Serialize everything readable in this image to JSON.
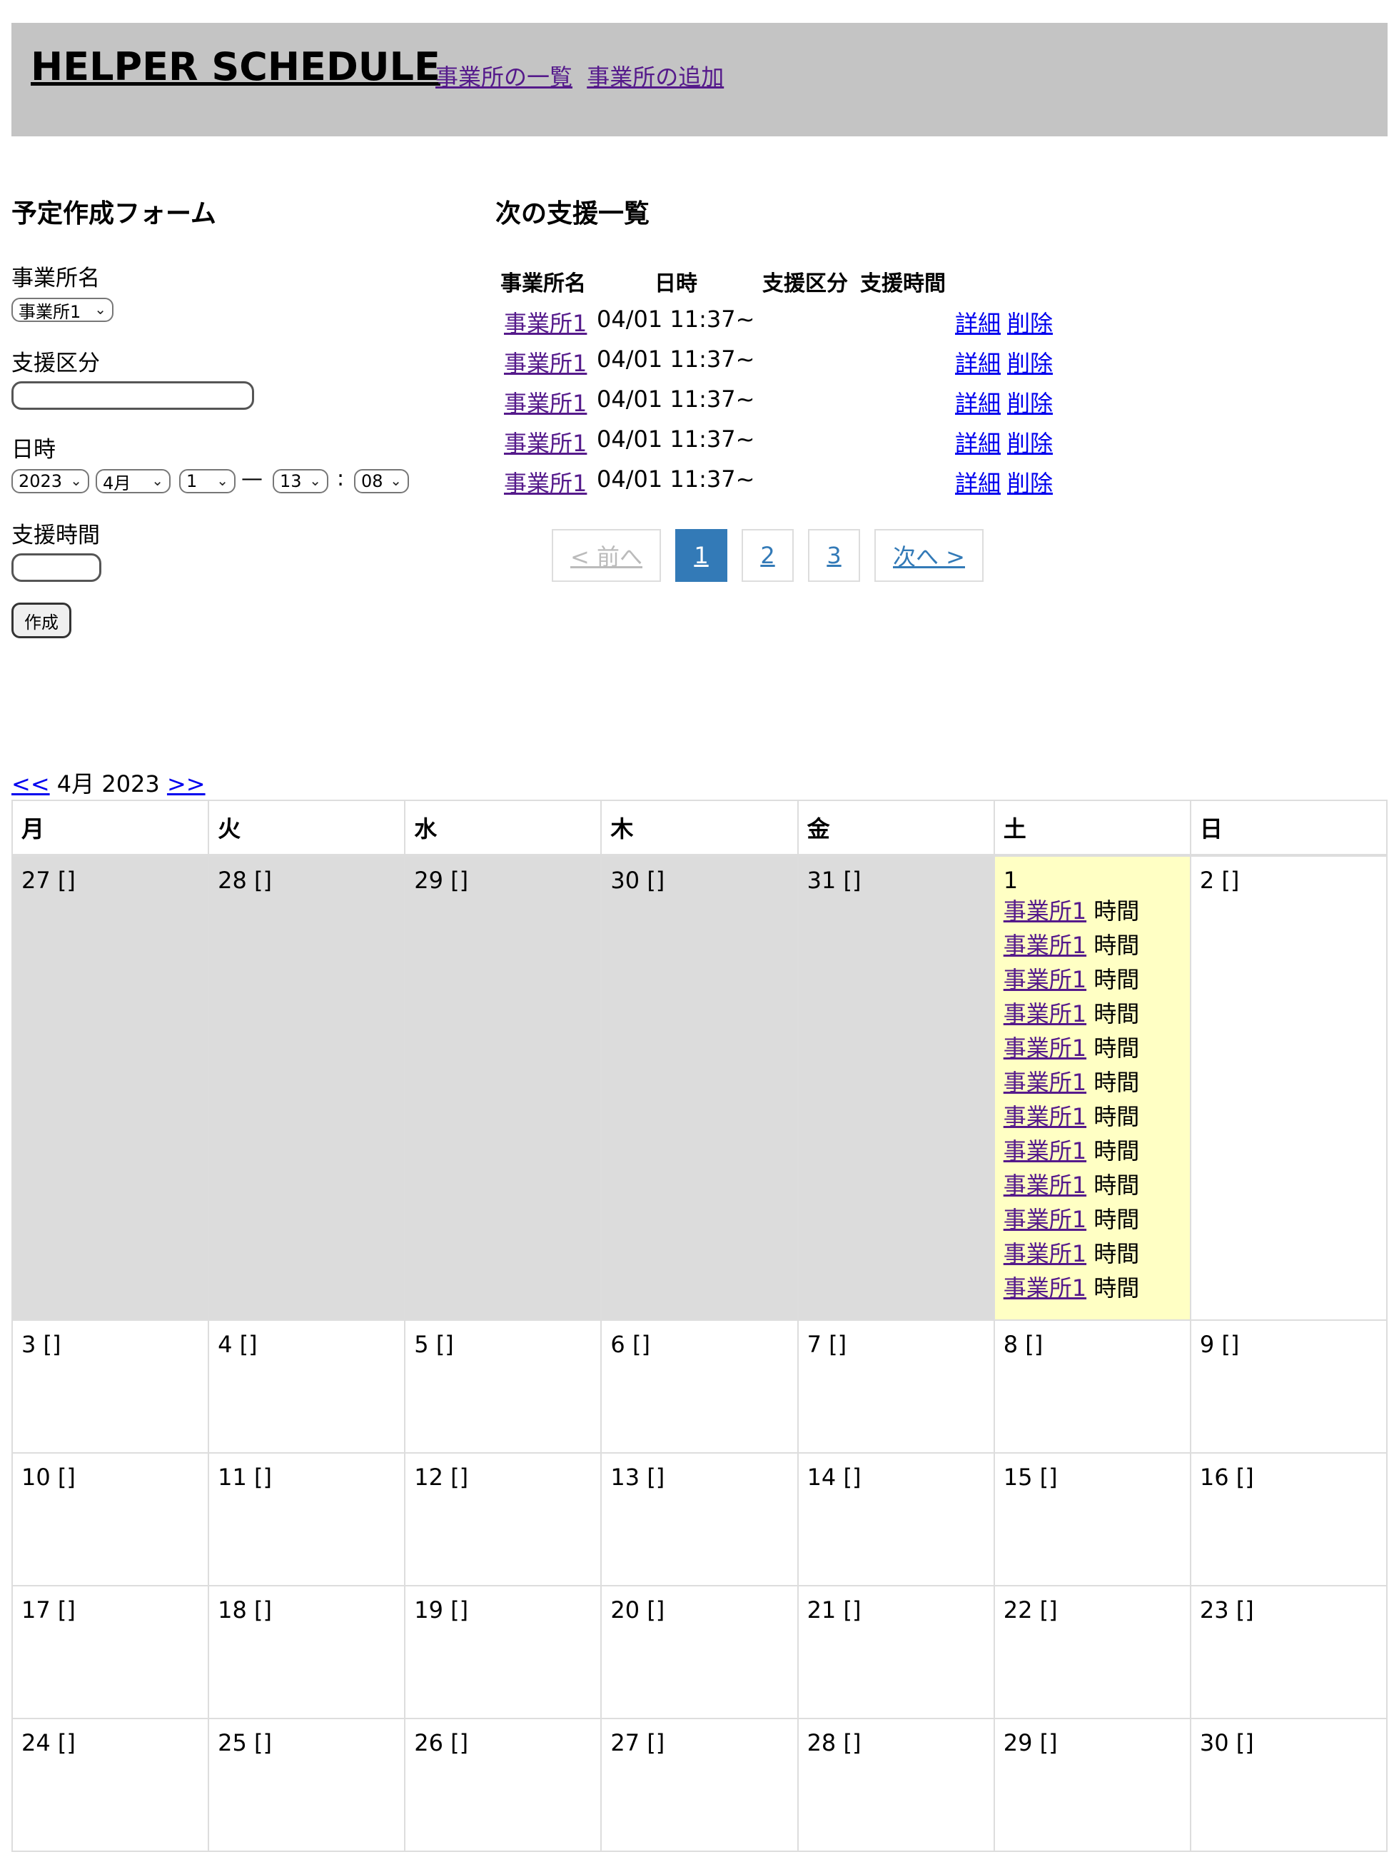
{
  "header": {
    "title": "HELPER SCHEDULE",
    "nav": [
      {
        "label": "事業所の一覧"
      },
      {
        "label": "事業所の追加"
      }
    ]
  },
  "form": {
    "heading": "予定作成フォーム",
    "office_label": "事業所名",
    "office_value": "事業所1",
    "category_label": "支援区分",
    "category_value": "",
    "datetime_label": "日時",
    "year": "2023",
    "month": "4月",
    "day": "1",
    "dash": "—",
    "hour": "13",
    "colon": ":",
    "minute": "08",
    "duration_label": "支援時間",
    "duration_value": "",
    "submit_label": "作成"
  },
  "upcoming": {
    "heading": "次の支援一覧",
    "columns": [
      "事業所名",
      "日時",
      "支援区分",
      "支援時間"
    ],
    "rows": [
      {
        "office": "事業所1",
        "datetime": "04/01 11:37~",
        "detail": "詳細",
        "delete": "削除"
      },
      {
        "office": "事業所1",
        "datetime": "04/01 11:37~",
        "detail": "詳細",
        "delete": "削除"
      },
      {
        "office": "事業所1",
        "datetime": "04/01 11:37~",
        "detail": "詳細",
        "delete": "削除"
      },
      {
        "office": "事業所1",
        "datetime": "04/01 11:37~",
        "detail": "詳細",
        "delete": "削除"
      },
      {
        "office": "事業所1",
        "datetime": "04/01 11:37~",
        "detail": "詳細",
        "delete": "削除"
      }
    ],
    "pagination": {
      "prev": "< 前へ",
      "pages": [
        "1",
        "2",
        "3"
      ],
      "current": "1",
      "next": "次へ >"
    }
  },
  "calendar": {
    "prev_link": "<<",
    "month_label": "4月 2023",
    "next_link": ">>",
    "weekdays": [
      "月",
      "火",
      "水",
      "木",
      "金",
      "土",
      "日"
    ],
    "weeks": [
      [
        {
          "day": "27",
          "suffix": " []",
          "type": "prev"
        },
        {
          "day": "28",
          "suffix": " []",
          "type": "prev"
        },
        {
          "day": "29",
          "suffix": " []",
          "type": "prev"
        },
        {
          "day": "30",
          "suffix": " []",
          "type": "prev"
        },
        {
          "day": "31",
          "suffix": " []",
          "type": "prev"
        },
        {
          "day": "1",
          "suffix": "",
          "type": "today",
          "events": [
            {
              "office": "事業所1",
              "text": " 時間"
            },
            {
              "office": "事業所1",
              "text": " 時間"
            },
            {
              "office": "事業所1",
              "text": " 時間"
            },
            {
              "office": "事業所1",
              "text": " 時間"
            },
            {
              "office": "事業所1",
              "text": " 時間"
            },
            {
              "office": "事業所1",
              "text": " 時間"
            },
            {
              "office": "事業所1",
              "text": " 時間"
            },
            {
              "office": "事業所1",
              "text": " 時間"
            },
            {
              "office": "事業所1",
              "text": " 時間"
            },
            {
              "office": "事業所1",
              "text": " 時間"
            },
            {
              "office": "事業所1",
              "text": " 時間"
            },
            {
              "office": "事業所1",
              "text": " 時間"
            }
          ]
        },
        {
          "day": "2",
          "suffix": " []",
          "type": "normal"
        }
      ],
      [
        {
          "day": "3",
          "suffix": " []"
        },
        {
          "day": "4",
          "suffix": " []"
        },
        {
          "day": "5",
          "suffix": " []"
        },
        {
          "day": "6",
          "suffix": " []"
        },
        {
          "day": "7",
          "suffix": " []"
        },
        {
          "day": "8",
          "suffix": " []"
        },
        {
          "day": "9",
          "suffix": " []"
        }
      ],
      [
        {
          "day": "10",
          "suffix": " []"
        },
        {
          "day": "11",
          "suffix": " []"
        },
        {
          "day": "12",
          "suffix": " []"
        },
        {
          "day": "13",
          "suffix": " []"
        },
        {
          "day": "14",
          "suffix": " []"
        },
        {
          "day": "15",
          "suffix": " []"
        },
        {
          "day": "16",
          "suffix": " []"
        }
      ],
      [
        {
          "day": "17",
          "suffix": " []"
        },
        {
          "day": "18",
          "suffix": " []"
        },
        {
          "day": "19",
          "suffix": " []"
        },
        {
          "day": "20",
          "suffix": " []"
        },
        {
          "day": "21",
          "suffix": " []"
        },
        {
          "day": "22",
          "suffix": " []"
        },
        {
          "day": "23",
          "suffix": " []"
        }
      ],
      [
        {
          "day": "24",
          "suffix": " []"
        },
        {
          "day": "25",
          "suffix": " []"
        },
        {
          "day": "26",
          "suffix": " []"
        },
        {
          "day": "27",
          "suffix": " []"
        },
        {
          "day": "28",
          "suffix": " []"
        },
        {
          "day": "29",
          "suffix": " []"
        },
        {
          "day": "30",
          "suffix": " []"
        }
      ]
    ]
  }
}
